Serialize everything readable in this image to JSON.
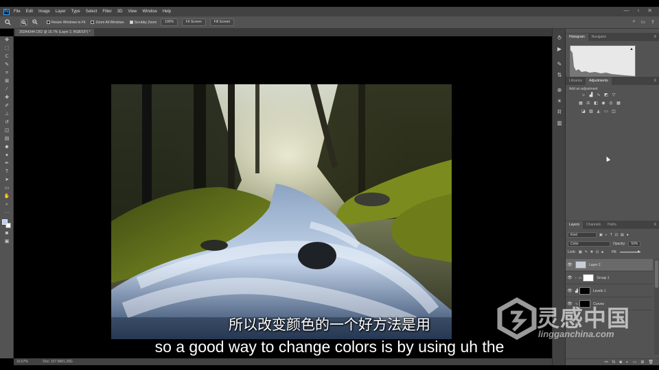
{
  "app": {
    "logo": "Ps"
  },
  "menu": [
    "File",
    "Edit",
    "Image",
    "Layer",
    "Type",
    "Select",
    "Filter",
    "3D",
    "View",
    "Window",
    "Help"
  ],
  "window_controls": [
    "—",
    "▫",
    "✕"
  ],
  "options_bar": {
    "resize_windows_label": "Resize Windows to Fit",
    "resize_windows_checked": false,
    "zoom_all_windows_label": "Zoom All Windows",
    "zoom_all_windows_checked": false,
    "scrubby_zoom_label": "Scrubby Zoom",
    "scrubby_zoom_checked": true,
    "btn_100": "100%",
    "btn_fit_screen": "Fit Screen",
    "btn_fill_screen": "Fill Screen"
  },
  "document": {
    "tab_title": "202A4344.CR2 @ 16.7% (Layer 2, RGB/16*) *"
  },
  "status": {
    "zoom": "16.67%",
    "doc_size": "Doc: 157.9M/1.29G"
  },
  "panels": {
    "histogram_tabs": [
      "Histogram",
      "Navigator"
    ],
    "adjustments_tabs": [
      "Libraries",
      "Adjustments"
    ],
    "adjustments_label": "Add an adjustment",
    "layers_tabs": [
      "Layers",
      "Channels",
      "Paths"
    ],
    "kind_filter": "Kind",
    "blend_mode": "Color",
    "opacity_label": "Opacity:",
    "opacity_value": "59%",
    "lock_label": "Lock:",
    "fill_label": "Fill:",
    "fill_value": "100%"
  },
  "layers": [
    {
      "name": "Layer 2",
      "selected": true,
      "thumb": "#c8cdd6"
    },
    {
      "name": "Group 1",
      "selected": false,
      "thumb": "#ffffff"
    },
    {
      "name": "Levels 1",
      "selected": false,
      "thumb": "#000000"
    },
    {
      "name": "Curves",
      "selected": false,
      "thumb": "#000000"
    }
  ],
  "subtitles": {
    "chinese": "所以改变颜色的一个好方法是用",
    "english": "so a good way to change colors is by using uh the"
  },
  "watermark": {
    "title": "灵感中国",
    "url": "lingganchina.com"
  },
  "colors": {
    "menubar": "#424242",
    "panel": "#535353",
    "accent_ps": "#31a8ff"
  }
}
